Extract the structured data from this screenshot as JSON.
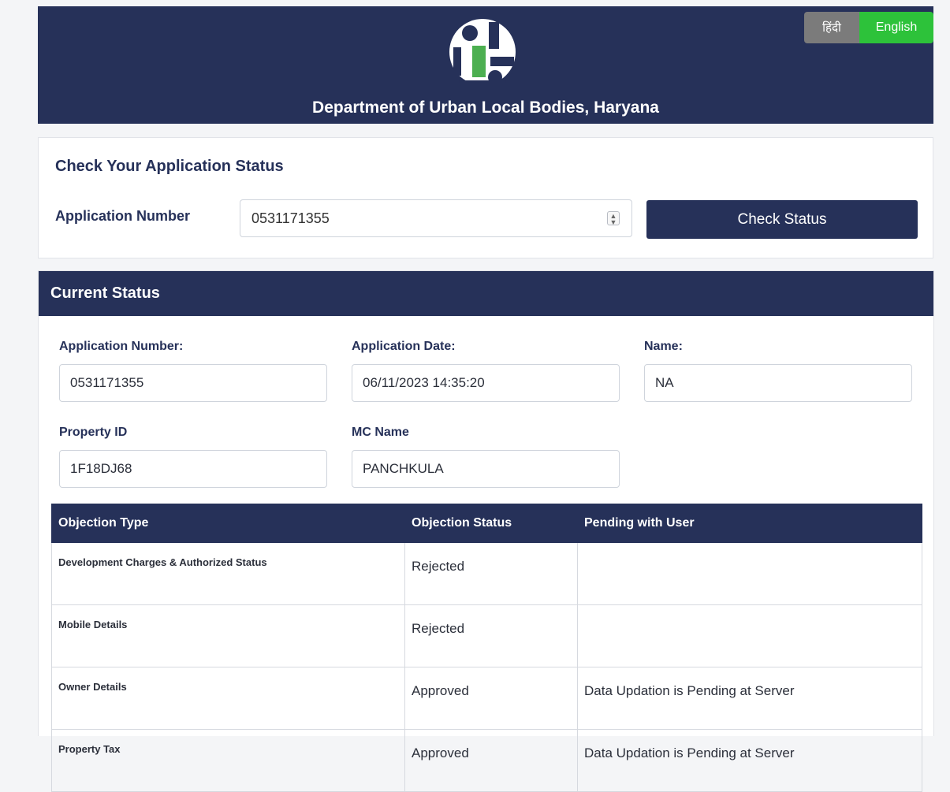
{
  "header": {
    "lang_hindi": "हिंदी",
    "lang_english": "English",
    "logo_icon": "ulb-haryana-logo",
    "title": "Department of Urban Local Bodies, Haryana"
  },
  "check": {
    "title": "Check Your Application Status",
    "app_label": "Application Number",
    "app_value": "0531171355",
    "button": "Check Status"
  },
  "status": {
    "title": "Current Status",
    "fields": {
      "app_number": {
        "label": "Application Number:",
        "value": "0531171355"
      },
      "app_date": {
        "label": "Application Date:",
        "value": "06/11/2023 14:35:20"
      },
      "name": {
        "label": "Name:",
        "value": "NA"
      },
      "property_id": {
        "label": "Property ID",
        "value": "1F18DJ68"
      },
      "mc_name": {
        "label": "MC Name",
        "value": "PANCHKULA"
      }
    },
    "table": {
      "headers": [
        "Objection Type",
        "Objection Status",
        "Pending with User"
      ],
      "rows": [
        [
          "Development Charges & Authorized Status",
          "Rejected",
          ""
        ],
        [
          "Mobile Details",
          "Rejected",
          ""
        ],
        [
          "Owner Details",
          "Approved",
          "Data Updation is Pending at Server"
        ],
        [
          "Property Tax",
          "Approved",
          "Data Updation is Pending at Server"
        ]
      ]
    }
  },
  "colors": {
    "navy": "#263159",
    "green": "#2dc23a",
    "grey_button": "#7b7b7b",
    "logo_accent": "#4caf50"
  }
}
